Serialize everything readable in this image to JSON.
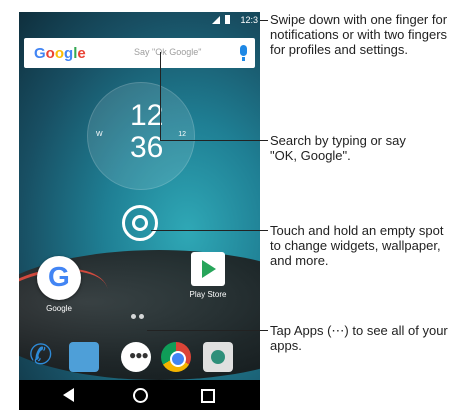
{
  "status": {
    "time": "12:3"
  },
  "search": {
    "logo": "Google",
    "hint": "Say \"Ok Google\""
  },
  "clock": {
    "hour": "12",
    "minute": "36",
    "left_label": "W",
    "right_label": "12"
  },
  "apps": {
    "google_label": "Google",
    "play_label": "Play Store"
  },
  "dock": {
    "apps_glyph": "●●●"
  },
  "callouts": [
    "Swipe down with one finger for notifications or with two fingers for profiles and settings.",
    "Search by typing or say \"OK, Google\".",
    "Touch and  hold an empty spot to change widgets, wallpaper, and more.",
    "Tap Apps (⋯) to see all of your apps."
  ]
}
